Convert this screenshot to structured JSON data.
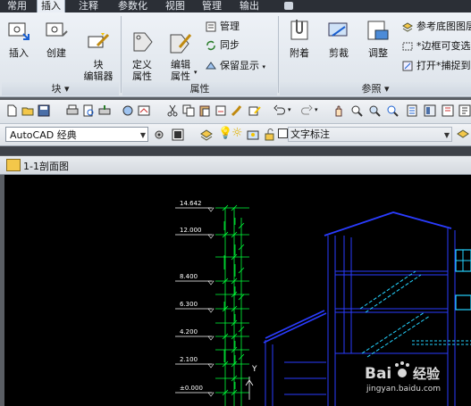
{
  "ribbon_tabs": [
    "常用",
    "插入",
    "注释",
    "参数化",
    "视图",
    "管理",
    "输出"
  ],
  "ribbon_tab_active_index": 1,
  "panels": {
    "block": {
      "label": "块",
      "buttons": {
        "insert": "插入",
        "create": "创建",
        "block_editor": "块\n编辑器"
      }
    },
    "attributes": {
      "label": "属性",
      "buttons": {
        "define": "定义\n属性",
        "edit": "编辑\n属性"
      },
      "small": {
        "manage": "管理",
        "sync": "同步",
        "retain": "保留显示"
      }
    },
    "reference": {
      "label": "参照",
      "buttons": {
        "attach": "附着",
        "clip": "剪裁",
        "adjust": "调整"
      },
      "small": {
        "underlay_layers": "参考底图图层",
        "frame_variable": "*边框可变选",
        "snap": "打开*捕捉到"
      }
    }
  },
  "workspace": "AutoCAD 经典",
  "text_style": "文字标注",
  "drawing_tab": "1-1剖面图",
  "drawing": {
    "elevations": [
      "14.642",
      "12.000",
      "8.400",
      "6.300",
      "4.200",
      "2.100",
      "±0.000"
    ],
    "ucs_label": "Y"
  },
  "watermark": {
    "brand": "Bai",
    "brand2": "经验",
    "url": "jingyan.baidu.com"
  },
  "colors": {
    "canvas": "#000000",
    "dim_green": "#00ff3a",
    "outline_blue": "#2a3cff",
    "cyan": "#25d3ff",
    "white": "#ffffff"
  }
}
